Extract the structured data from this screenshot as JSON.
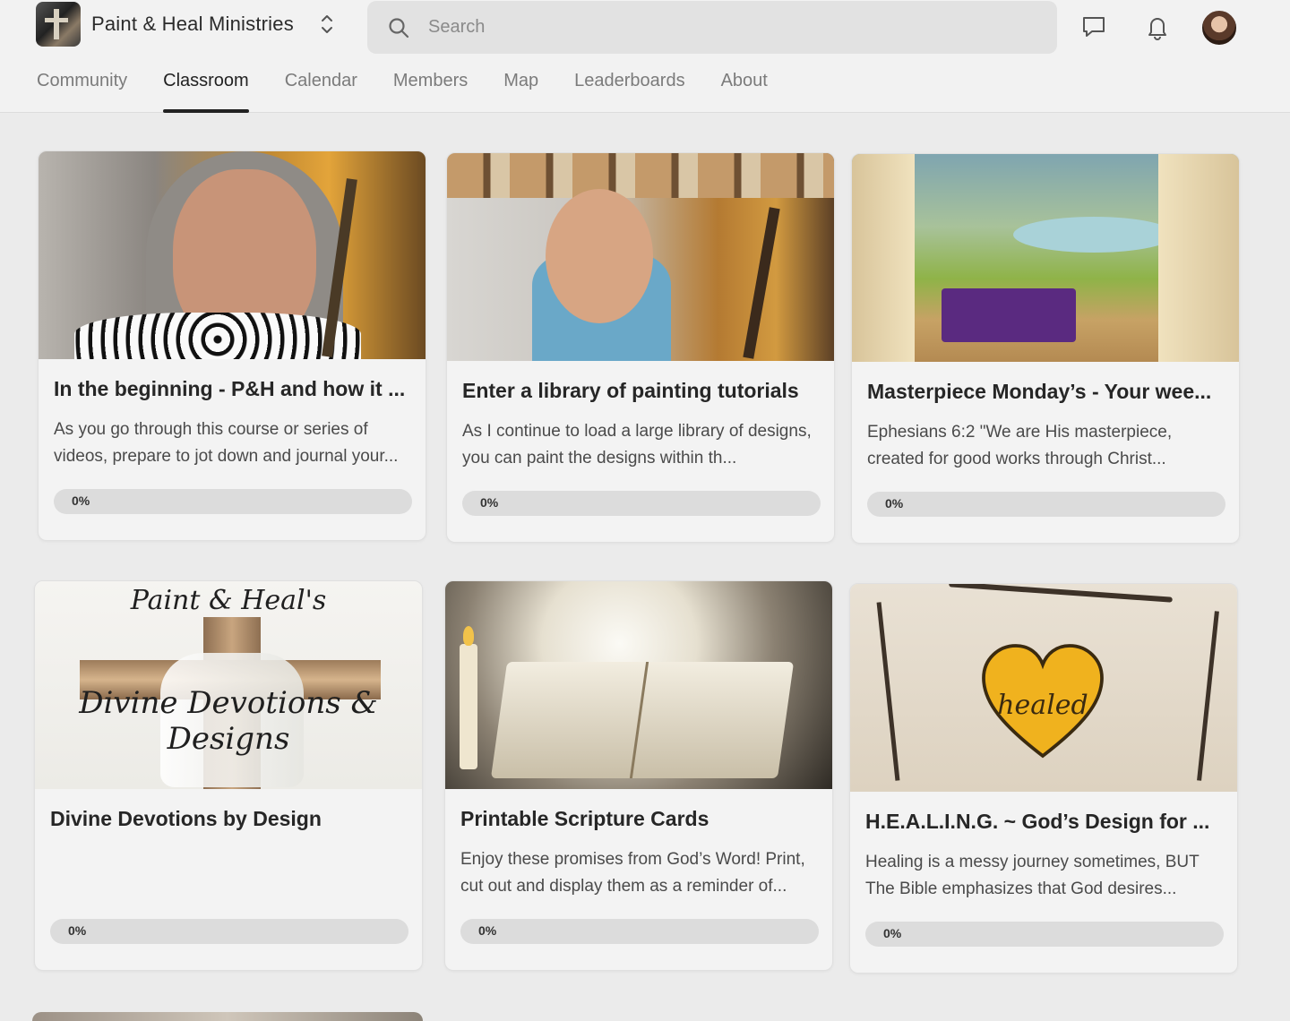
{
  "brand": {
    "name": "Paint & Heal Ministries"
  },
  "search": {
    "placeholder": "Search"
  },
  "nav": {
    "tabs": [
      {
        "label": "Community"
      },
      {
        "label": "Classroom",
        "active": true
      },
      {
        "label": "Calendar"
      },
      {
        "label": "Members"
      },
      {
        "label": "Map"
      },
      {
        "label": "Leaderboards"
      },
      {
        "label": "About"
      }
    ]
  },
  "courses": [
    {
      "title": "In the beginning - P&H and how it ...",
      "description": "As you go through this course or series of videos, prepare to jot down and journal your...",
      "progress_label": "0%",
      "progress": 0
    },
    {
      "title": "Enter a library of painting tutorials",
      "description": "As I continue to load a large library of designs, you can paint the designs within th...",
      "progress_label": "0%",
      "progress": 0
    },
    {
      "title": "Masterpiece Monday’s - Your wee...",
      "description": "Ephesians 6:2 \"We are His masterpiece, created for good works through Christ...",
      "progress_label": "0%",
      "progress": 0
    },
    {
      "title": "Divine Devotions by Design",
      "description": "",
      "thumb_text_top": "Paint & Heal's",
      "thumb_text_mid": "Divine Devotions & Designs",
      "progress_label": "0%",
      "progress": 0
    },
    {
      "title": "Printable Scripture Cards",
      "description": "Enjoy these promises from God’s Word! Print, cut out and display them as a reminder of...",
      "progress_label": "0%",
      "progress": 0
    },
    {
      "title": "H.E.A.L.I.N.G. ~ God’s Design for ...",
      "description": "Healing is a messy journey sometimes, BUT The Bible emphasizes that God desires...",
      "thumb_text": "healed",
      "progress_label": "0%",
      "progress": 0
    }
  ],
  "colors": {
    "accent": "#222222",
    "progress_track": "#dcdcdc",
    "background": "#ebebeb"
  },
  "icons": [
    "switcher-icon",
    "search-icon",
    "chat-icon",
    "bell-icon"
  ]
}
